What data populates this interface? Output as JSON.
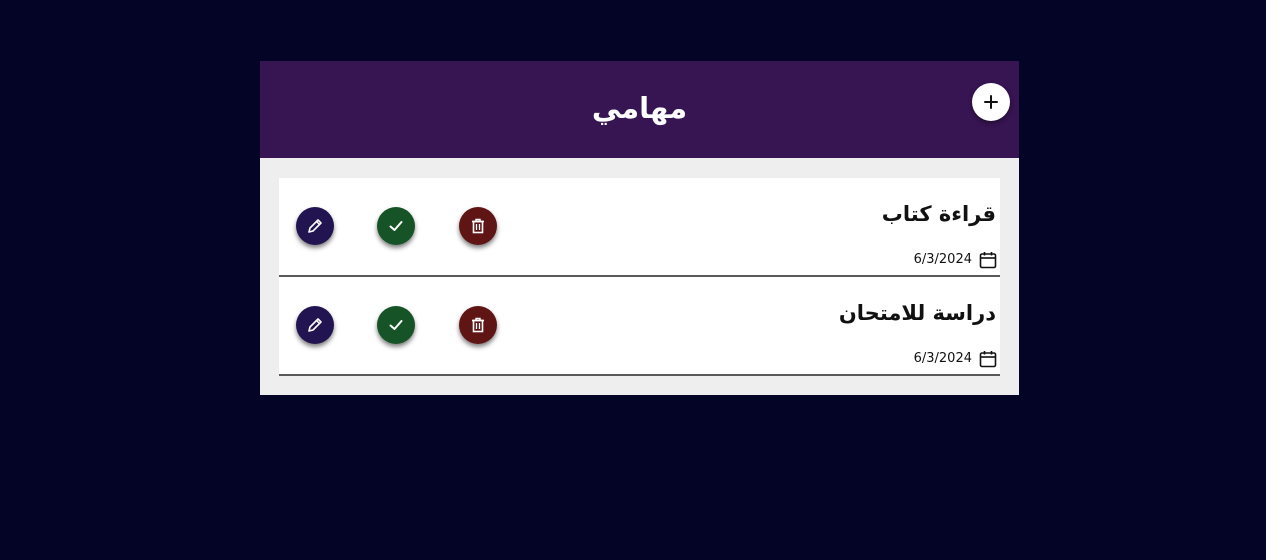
{
  "header": {
    "title": "مهامي",
    "add_icon": "plus-icon",
    "color": "#371452"
  },
  "colors": {
    "page_background": "#040426",
    "edit": "#221450",
    "done": "#165327",
    "delete": "#5e1513"
  },
  "tasks": [
    {
      "title": "قراءة كتاب",
      "date": "6/3/2024",
      "icons": [
        "calendar-icon",
        "delete-icon",
        "check-icon",
        "pencil-icon"
      ]
    },
    {
      "title": "دراسة للامتحان",
      "date": "6/3/2024",
      "icons": [
        "calendar-icon",
        "delete-icon",
        "check-icon",
        "pencil-icon"
      ]
    }
  ]
}
